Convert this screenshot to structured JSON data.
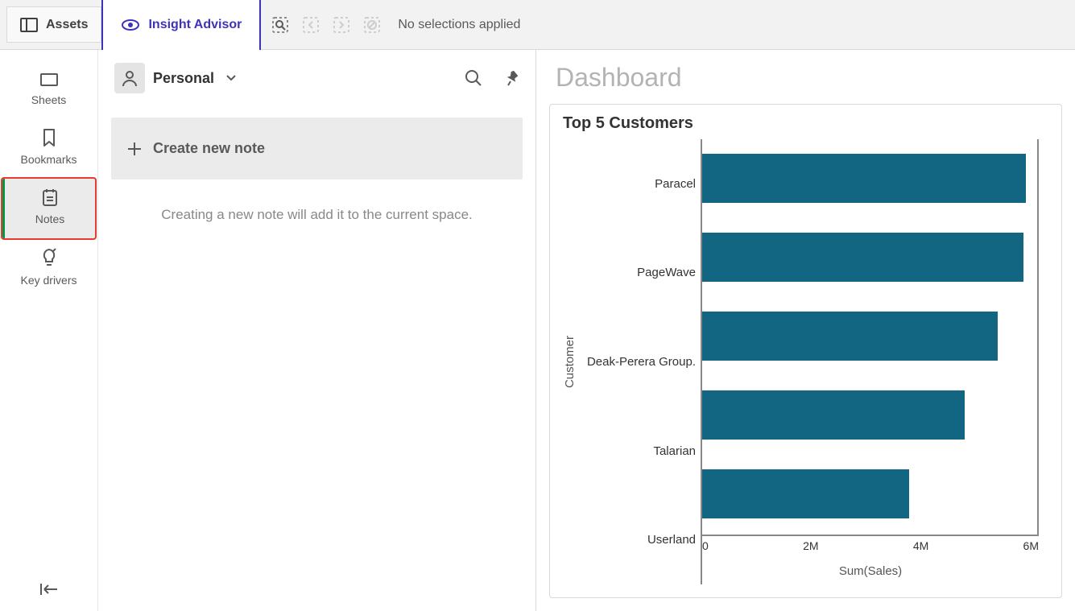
{
  "topbar": {
    "assets_label": "Assets",
    "insight_label": "Insight Advisor",
    "no_selections": "No selections applied"
  },
  "sidebar": {
    "sheets": "Sheets",
    "bookmarks": "Bookmarks",
    "notes": "Notes",
    "keydrivers": "Key drivers"
  },
  "notes_panel": {
    "scope_label": "Personal",
    "create_label": "Create new note",
    "hint": "Creating a new note will add it to the current space."
  },
  "dashboard": {
    "title": "Dashboard"
  },
  "chart_data": {
    "type": "bar",
    "title": "Top 5 Customers",
    "ylabel": "Customer",
    "xlabel": "Sum(Sales)",
    "x_ticks": [
      "0",
      "2M",
      "4M",
      "6M"
    ],
    "xlim": [
      0,
      6000000
    ],
    "categories": [
      "Paracel",
      "PageWave",
      "Deak-Perera Group.",
      "Talarian",
      "Userland"
    ],
    "values": [
      5800000,
      5750000,
      5300000,
      4700000,
      3700000
    ],
    "bar_color": "#136682"
  }
}
